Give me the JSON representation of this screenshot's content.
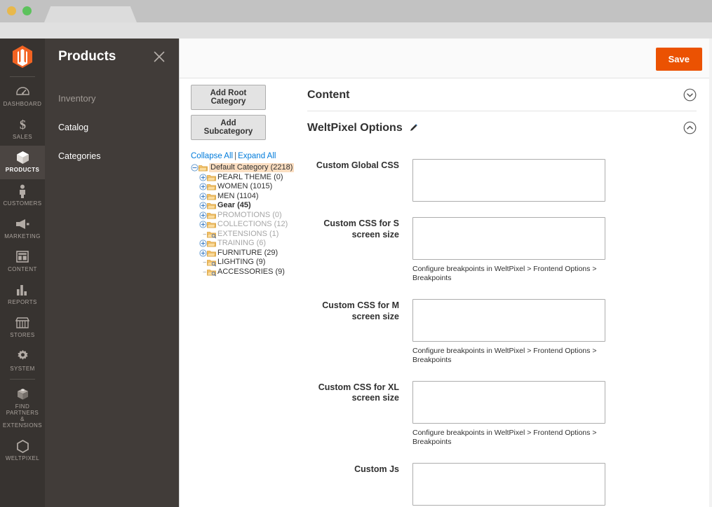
{
  "browser": {
    "traffic_lights": [
      "yellow",
      "green"
    ],
    "tab_title": ""
  },
  "rail": {
    "logo": "magento-logo",
    "items": [
      {
        "label": "Dashboard",
        "icon": "dashboard-icon",
        "active": false
      },
      {
        "label": "Sales",
        "icon": "dollar-icon",
        "active": false
      },
      {
        "label": "Products",
        "icon": "box-icon",
        "active": true
      },
      {
        "label": "Customers",
        "icon": "person-icon",
        "active": false
      },
      {
        "label": "Marketing",
        "icon": "megaphone-icon",
        "active": false
      },
      {
        "label": "Content",
        "icon": "layout-icon",
        "active": false
      },
      {
        "label": "Reports",
        "icon": "bar-chart-icon",
        "active": false
      },
      {
        "label": "Stores",
        "icon": "storefront-icon",
        "active": false
      },
      {
        "label": "System",
        "icon": "gear-icon",
        "active": false
      },
      {
        "label": "Find Partners\n& Extensions",
        "icon": "puzzle-box-icon",
        "active": false
      },
      {
        "label": "Weltpixel",
        "icon": "hexagon-icon",
        "active": false
      }
    ]
  },
  "flyout": {
    "title": "Products",
    "close_icon": "close-icon",
    "section_label": "Inventory",
    "links": [
      {
        "label": "Catalog"
      },
      {
        "label": "Categories"
      }
    ]
  },
  "header": {
    "save_label": "Save"
  },
  "tree_panel": {
    "add_root_label": "Add Root Category",
    "add_sub_label": "Add Subcategory",
    "collapse_all_label": "Collapse All",
    "separator": "|",
    "expand_all_label": "Expand All",
    "nodes": [
      {
        "label": "Default Category (2218)",
        "depth": 0,
        "handle": "minus",
        "folder": "folder-open",
        "state": "selected"
      },
      {
        "label": "PEARL THEME (0)",
        "depth": 1,
        "handle": "plus",
        "folder": "folder",
        "state": "normal"
      },
      {
        "label": "WOMEN (1015)",
        "depth": 1,
        "handle": "plus",
        "folder": "folder",
        "state": "normal"
      },
      {
        "label": "MEN (1104)",
        "depth": 1,
        "handle": "plus",
        "folder": "folder",
        "state": "normal"
      },
      {
        "label": "Gear (45)",
        "depth": 1,
        "handle": "plus",
        "folder": "folder",
        "state": "bold"
      },
      {
        "label": "PROMOTIONS (0)",
        "depth": 1,
        "handle": "plus",
        "folder": "folder",
        "state": "muted"
      },
      {
        "label": "COLLECTIONS (12)",
        "depth": 1,
        "handle": "plus",
        "folder": "folder",
        "state": "muted"
      },
      {
        "label": "EXTENSIONS (1)",
        "depth": 1,
        "handle": "leaf",
        "folder": "folder-leaf",
        "state": "muted"
      },
      {
        "label": "TRAINING (6)",
        "depth": 1,
        "handle": "plus",
        "folder": "folder",
        "state": "muted"
      },
      {
        "label": "FURNITURE (29)",
        "depth": 1,
        "handle": "plus",
        "folder": "folder",
        "state": "normal"
      },
      {
        "label": "LIGHTING (9)",
        "depth": 1,
        "handle": "leaf",
        "folder": "folder-leaf",
        "state": "normal"
      },
      {
        "label": "ACCESSORIES (9)",
        "depth": 1,
        "handle": "leaf",
        "folder": "folder-leaf",
        "state": "normal"
      }
    ]
  },
  "content_section": {
    "title": "Content",
    "toggle_icon": "chevron-down-icon",
    "expanded": false
  },
  "weltpixel_section": {
    "title": "WeltPixel Options",
    "edit_icon": "pencil-icon",
    "toggle_icon": "chevron-up-icon",
    "expanded": true,
    "breakpoint_note": "Configure breakpoints in WeltPixel > Frontend Options > Breakpoints",
    "fields": [
      {
        "label": "Custom Global CSS",
        "value": "",
        "placeholder": "",
        "note": ""
      },
      {
        "label": "Custom CSS for S screen size",
        "value": "",
        "placeholder": "",
        "note": "Configure breakpoints in WeltPixel > Frontend Options > Breakpoints"
      },
      {
        "label": "Custom CSS for M screen size",
        "value": "",
        "placeholder": "",
        "note": "Configure breakpoints in WeltPixel > Frontend Options > Breakpoints"
      },
      {
        "label": "Custom CSS for XL screen size",
        "value": "",
        "placeholder": "",
        "note": "Configure breakpoints in WeltPixel > Frontend Options > Breakpoints"
      },
      {
        "label": "Custom Js",
        "value": "",
        "placeholder": "",
        "note": ""
      }
    ]
  },
  "colors": {
    "accent": "#eb5202",
    "rail_bg": "#373330",
    "flyout_bg": "#413c39",
    "link": "#007bdb",
    "selected_node": "#fbdec1"
  }
}
